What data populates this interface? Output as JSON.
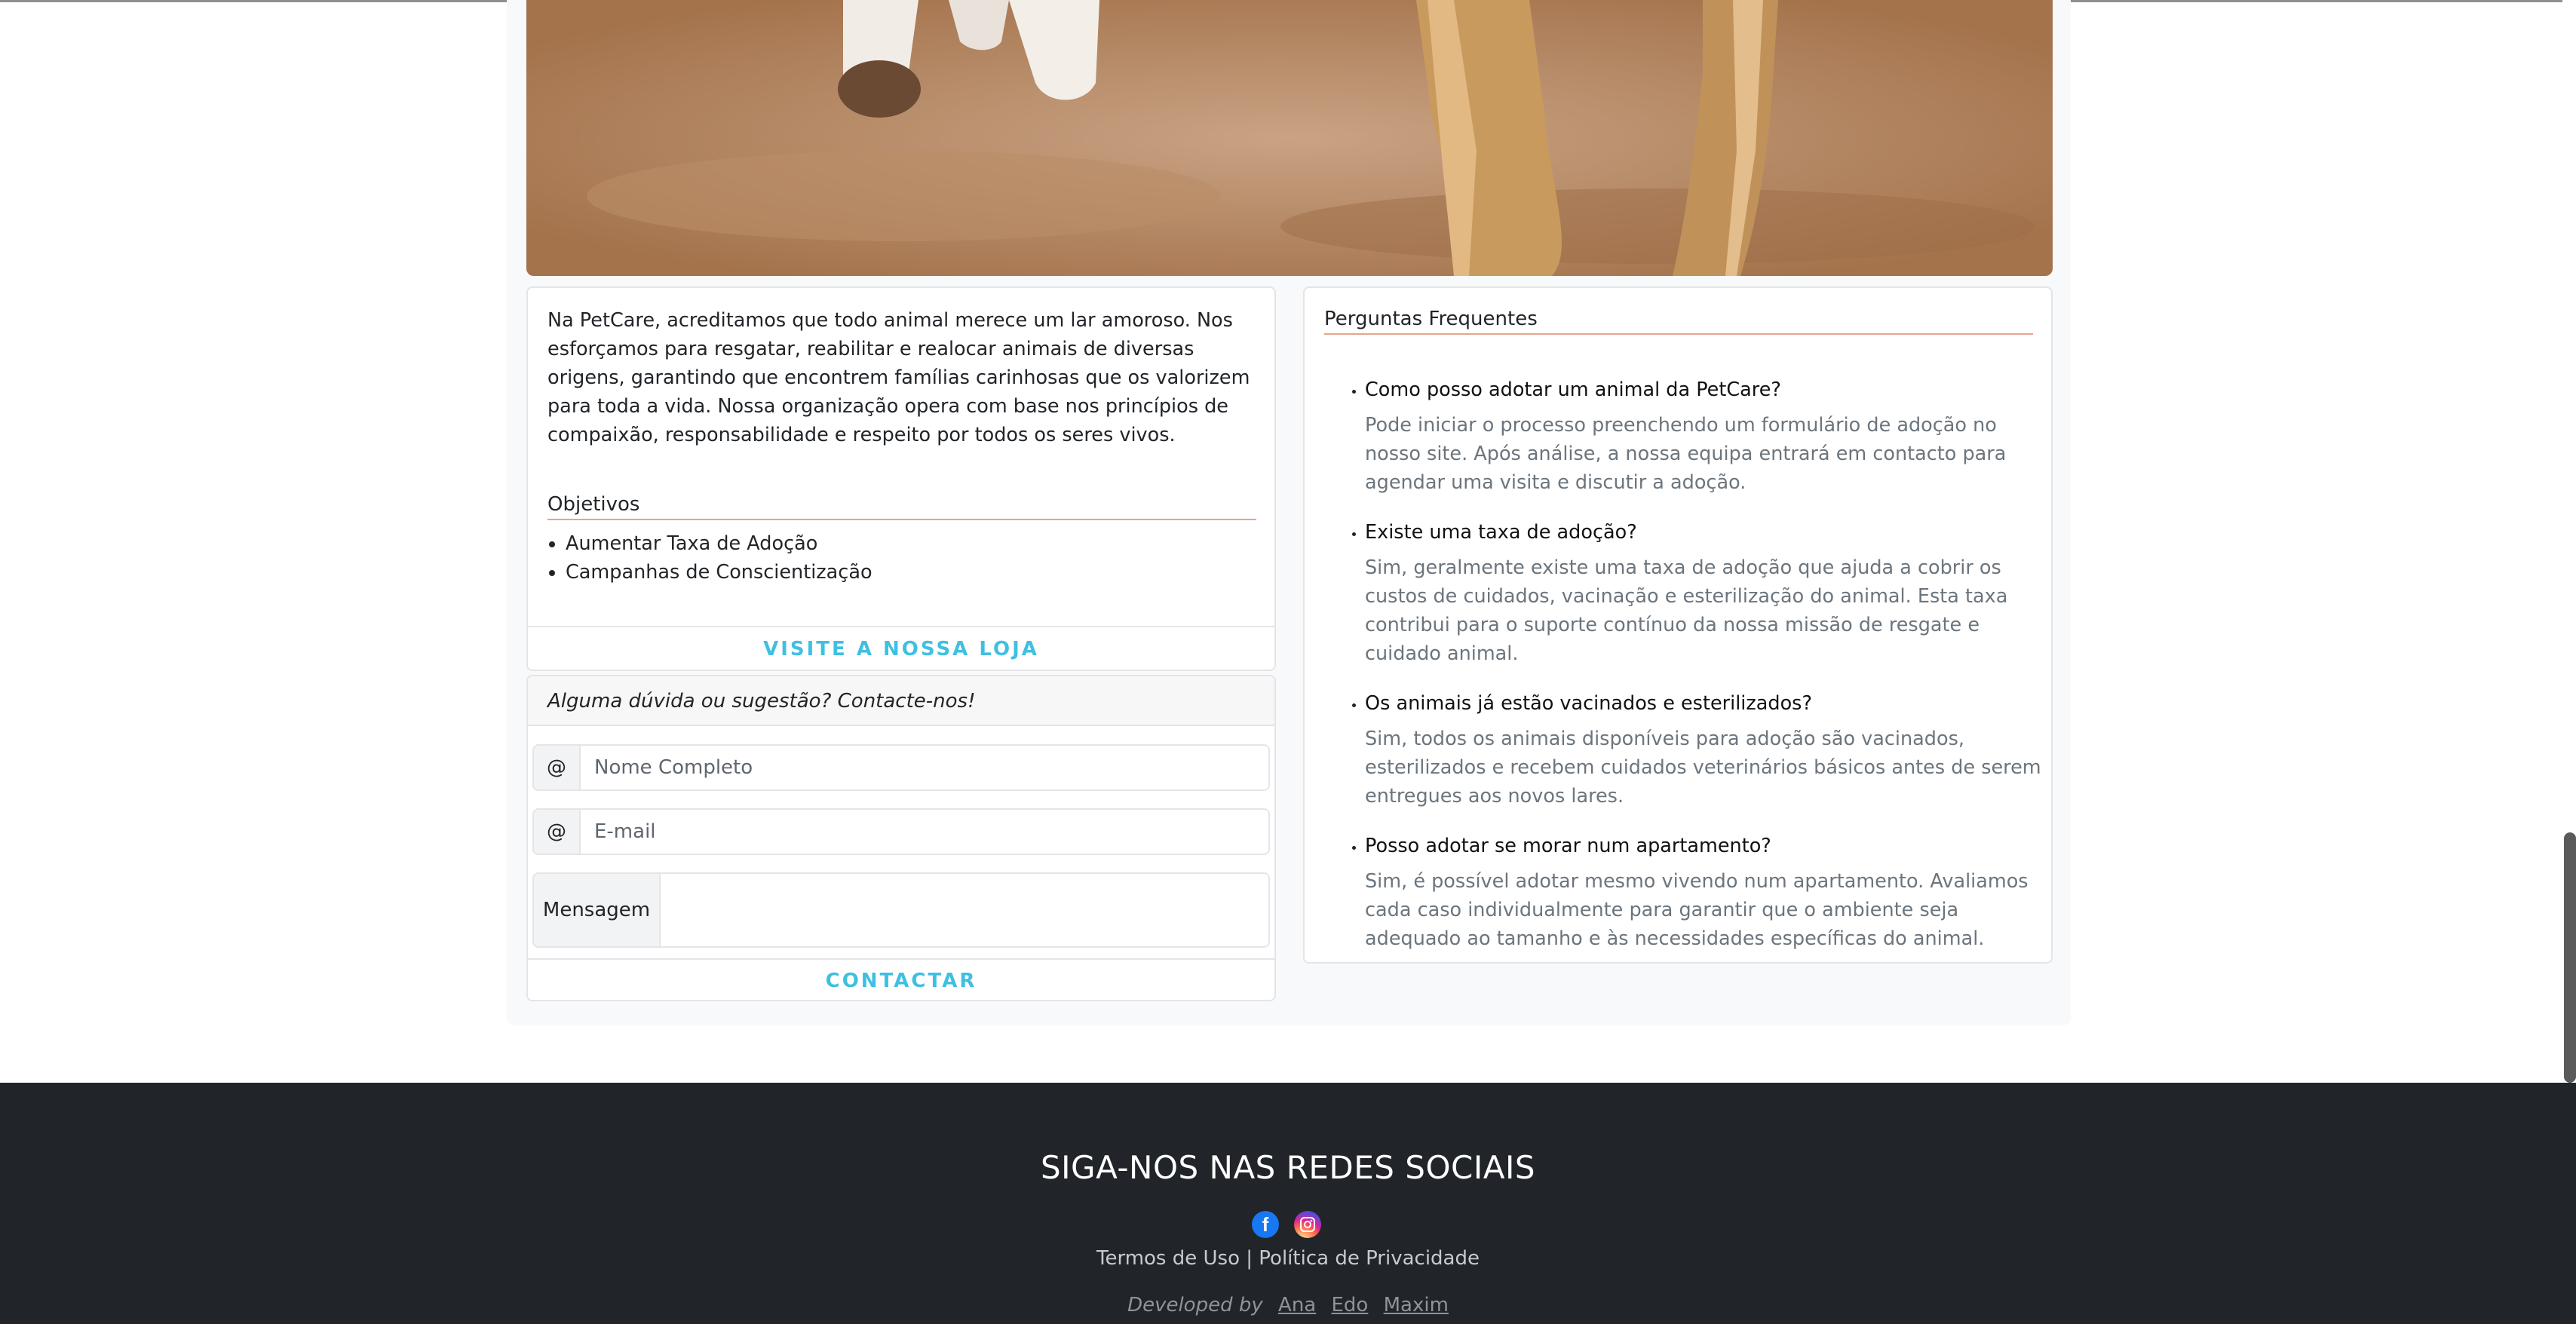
{
  "about": {
    "paragraph": "Na PetCare, acreditamos que todo animal merece um lar amoroso. Nos esforçamos para resgatar, reabilitar e realocar animais de diversas origens, garantindo que encontrem famílias carinhosas que os valorizem para toda a vida. Nossa organização opera com base nos princípios de compaixão, responsabilidade e respeito por todos os seres vivos.",
    "objectives_title": "Objetivos",
    "objectives": [
      "Aumentar Taxa de Adoção",
      "Campanhas de Conscientização"
    ],
    "store_button": "VISITE A NOSSA LOJA"
  },
  "contact": {
    "header": "Alguma dúvida ou sugestão? Contacte-nos!",
    "name_addon": "@",
    "name_placeholder": "Nome Completo",
    "email_addon": "@",
    "email_placeholder": "E-mail",
    "message_label": "Mensagem",
    "submit_button": "CONTACTAR"
  },
  "faq": {
    "title": "Perguntas Frequentes",
    "items": [
      {
        "q": "Como posso adotar um animal da PetCare?",
        "a": "Pode iniciar o processo preenchendo um formulário de adoção no nosso site. Após análise, a nossa equipa entrará em contacto para agendar uma visita e discutir a adoção."
      },
      {
        "q": "Existe uma taxa de adoção?",
        "a": "Sim, geralmente existe uma taxa de adoção que ajuda a cobrir os custos de cuidados, vacinação e esterilização do animal. Esta taxa contribui para o suporte contínuo da nossa missão de resgate e cuidado animal."
      },
      {
        "q": "Os animais já estão vacinados e esterilizados?",
        "a": "Sim, todos os animais disponíveis para adoção são vacinados, esterilizados e recebem cuidados veterinários básicos antes de serem entregues aos novos lares."
      },
      {
        "q": "Posso adotar se morar num apartamento?",
        "a": "Sim, é possível adotar mesmo vivendo num apartamento. Avaliamos cada caso individualmente para garantir que o ambiente seja adequado ao tamanho e às necessidades específicas do animal."
      }
    ]
  },
  "footer": {
    "follow_title": "SIGA-NOS NAS REDES SOCIAIS",
    "social_icons": [
      "facebook-icon",
      "instagram-icon"
    ],
    "terms": "Termos de Uso",
    "separator": "|",
    "privacy": "Política de Privacidade",
    "developed_by": "Developed by",
    "developers": [
      "Ana",
      "Edo",
      "Maxim"
    ]
  },
  "colors": {
    "accent_link": "#3fc0e1",
    "underline_accent": "#e6a58a",
    "footer_bg": "#212529"
  }
}
